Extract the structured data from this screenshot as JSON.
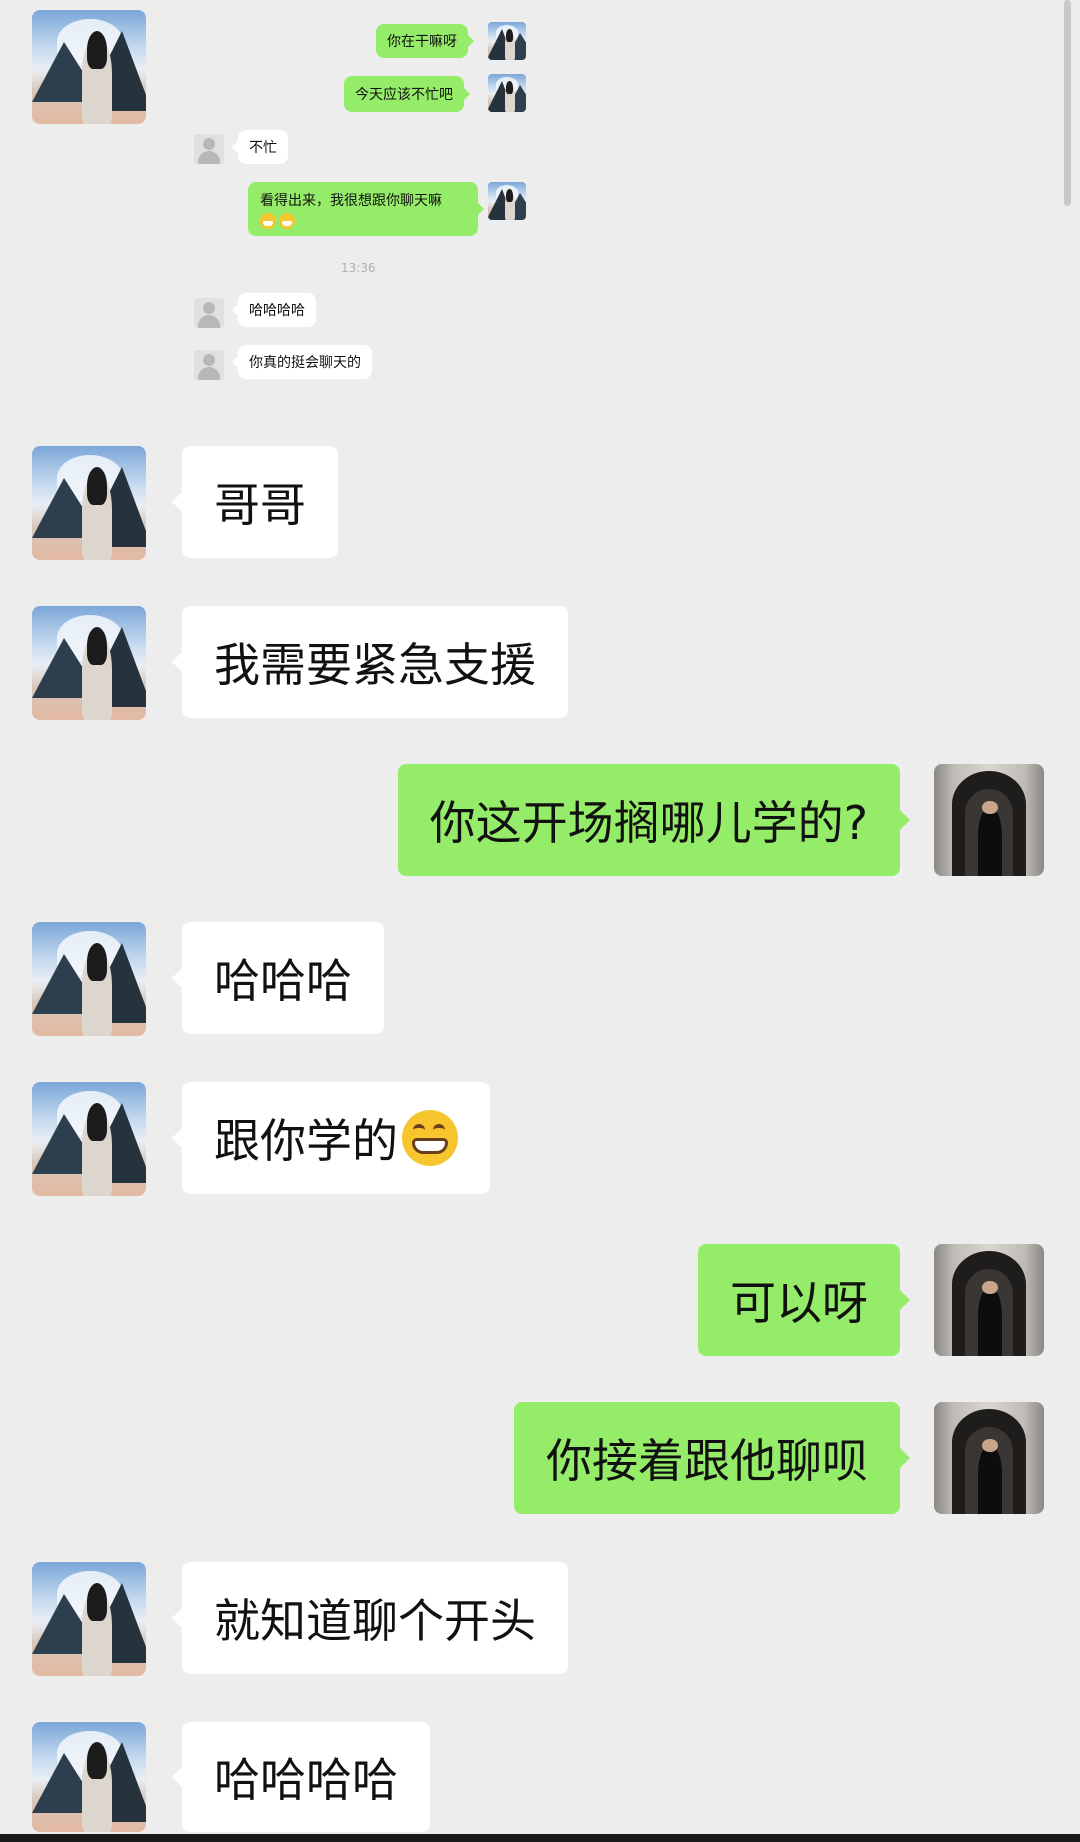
{
  "embedded_screenshot": {
    "messages": [
      {
        "side": "right",
        "text": "你在干嘛呀"
      },
      {
        "side": "right",
        "text": "今天应该不忙吧"
      },
      {
        "side": "left",
        "text": "不忙"
      },
      {
        "side": "right",
        "text": "看得出来，我很想跟你聊天嘛",
        "emoji": [
          "grin-icon",
          "grin-icon"
        ]
      },
      {
        "side": "left",
        "text": "哈哈哈哈"
      },
      {
        "side": "left",
        "text": "你真的挺会聊天的"
      }
    ],
    "timestamp": "13:36"
  },
  "chat": {
    "messages": [
      {
        "side": "left",
        "text": "哥哥"
      },
      {
        "side": "left",
        "text": "我需要紧急支援"
      },
      {
        "side": "right",
        "text": "你这开场搁哪儿学的?"
      },
      {
        "side": "left",
        "text": "哈哈哈"
      },
      {
        "side": "left",
        "text": "跟你学的",
        "emoji": "grin-icon"
      },
      {
        "side": "right",
        "text": "可以呀"
      },
      {
        "side": "right",
        "text": "你接着跟他聊呗"
      },
      {
        "side": "left",
        "text": "就知道聊个开头"
      },
      {
        "side": "left",
        "text": "哈哈哈哈"
      }
    ]
  },
  "colors": {
    "background": "#ededed",
    "bubble_green": "#95ec69",
    "bubble_white": "#ffffff"
  }
}
